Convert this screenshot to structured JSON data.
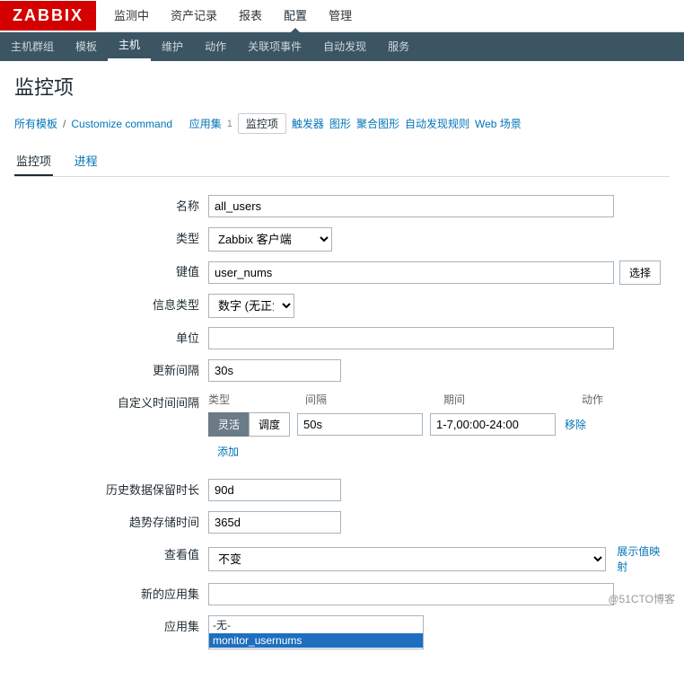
{
  "logo": "ZABBIX",
  "topnav": [
    "监测中",
    "资产记录",
    "报表",
    "配置",
    "管理"
  ],
  "topnav_active": 3,
  "subnav": [
    "主机群组",
    "模板",
    "主机",
    "维护",
    "动作",
    "关联项事件",
    "自动发现",
    "服务"
  ],
  "subnav_active": 2,
  "page_title": "监控项",
  "breadcrumb": {
    "all_templates": "所有模板",
    "template": "Customize command",
    "items": [
      {
        "label": "应用集",
        "count": "1"
      },
      {
        "label": "监控项",
        "active": true
      },
      {
        "label": "触发器"
      },
      {
        "label": "图形"
      },
      {
        "label": "聚合图形"
      },
      {
        "label": "自动发现规则"
      },
      {
        "label": "Web 场景"
      }
    ]
  },
  "tabs": [
    {
      "label": "监控项",
      "active": true
    },
    {
      "label": "进程"
    }
  ],
  "form": {
    "name_label": "名称",
    "name_value": "all_users",
    "type_label": "类型",
    "type_value": "Zabbix 客户端",
    "key_label": "键值",
    "key_value": "user_nums",
    "key_select_btn": "选择",
    "info_label": "信息类型",
    "info_value": "数字 (无正负)",
    "unit_label": "单位",
    "unit_value": "",
    "interval_label": "更新间隔",
    "interval_value": "30s",
    "custom_label": "自定义时间间隔",
    "custom_headers": {
      "type": "类型",
      "interval": "间隔",
      "period": "期间",
      "action": "动作"
    },
    "seg_flex": "灵活",
    "seg_sched": "调度",
    "custom_interval": "50s",
    "custom_period": "1-7,00:00-24:00",
    "remove": "移除",
    "add": "添加",
    "history_label": "历史数据保留时长",
    "history_value": "90d",
    "trend_label": "趋势存储时间",
    "trend_value": "365d",
    "view_label": "查看值",
    "view_value": "不变",
    "view_map": "展示值映射",
    "newapp_label": "新的应用集",
    "newapp_value": "",
    "app_label": "应用集",
    "app_none": "-无-",
    "app_item": "monitor_usernums"
  },
  "watermark": "@51CTO博客"
}
